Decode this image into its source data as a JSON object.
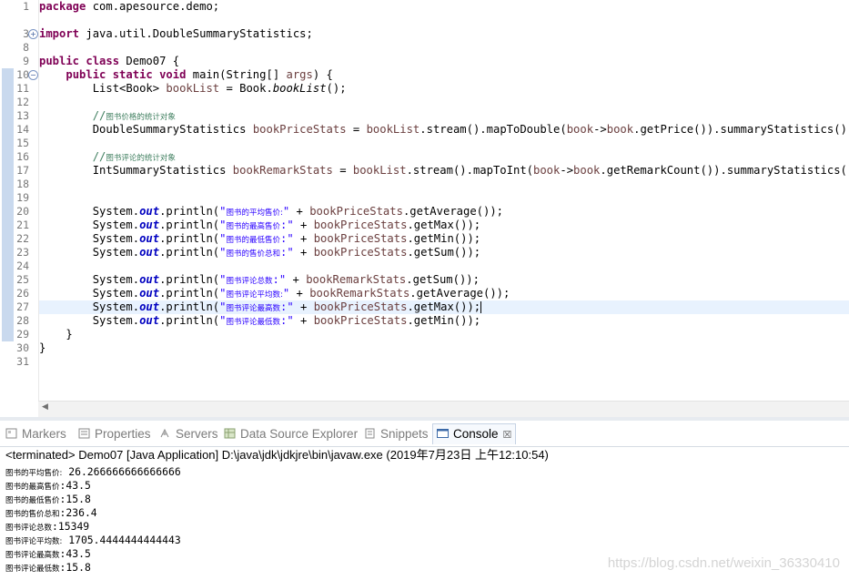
{
  "editor": {
    "line_numbers": [
      "1",
      "3",
      "8",
      "9",
      "10",
      "11",
      "12",
      "13",
      "14",
      "15",
      "16",
      "17",
      "18",
      "19",
      "20",
      "21",
      "22",
      "23",
      "24",
      "25",
      "26",
      "27",
      "28",
      "29",
      "30",
      "31"
    ],
    "lines": {
      "l1": {
        "kw": "package",
        "rest": " com.apesource.demo;"
      },
      "l3": {
        "kw": "import",
        "rest": " java.util.DoubleSummaryStatistics;"
      },
      "l9": {
        "kw": "public class",
        "rest": " Demo07 {"
      },
      "l10": {
        "kw": "public static void",
        "rest": " main(String[] ",
        "var": "args",
        "tail": ") {"
      },
      "l11": {
        "pre": "List<Book> ",
        "var": "bookList",
        "mid": " = Book.",
        "it": "bookList",
        "tail": "();"
      },
      "l13": {
        "comment_prefix": "//",
        "comment": "图书价格的统计对象"
      },
      "l14": {
        "pre": "DoubleSummaryStatistics ",
        "var": "bookPriceStats",
        "mid": " = ",
        "var2": "bookList",
        "mid2": ".stream().mapToDouble(",
        "var3": "book",
        "mid3": "->",
        "var4": "book",
        "tail": ".getPrice()).summaryStatistics();"
      },
      "l16": {
        "comment_prefix": "//",
        "comment": "图书评论的统计对象"
      },
      "l17": {
        "pre": "IntSummaryStatistics ",
        "var": "bookRemarkStats",
        "mid": " = ",
        "var2": "bookList",
        "mid2": ".stream().mapToInt(",
        "var3": "book",
        "mid3": "->",
        "var4": "book",
        "tail": ".getRemarkCount()).summaryStatistics();"
      },
      "l20": {
        "pre": "System.",
        "fld": "out",
        "mid": ".println(",
        "str_q": "\"",
        "str_cn": "图书的平均售价:",
        "str_end": "\"",
        "plus": " + ",
        "var": "bookPriceStats",
        "tail": ".getAverage());"
      },
      "l21": {
        "pre": "System.",
        "fld": "out",
        "mid": ".println(",
        "str_q": "\"",
        "str_cn": "图书的最高售价",
        "str_end": ":\"",
        "plus": " + ",
        "var": "bookPriceStats",
        "tail": ".getMax());"
      },
      "l22": {
        "pre": "System.",
        "fld": "out",
        "mid": ".println(",
        "str_q": "\"",
        "str_cn": "图书的最低售价",
        "str_end": ":\"",
        "plus": " + ",
        "var": "bookPriceStats",
        "tail": ".getMin());"
      },
      "l23": {
        "pre": "System.",
        "fld": "out",
        "mid": ".println(",
        "str_q": "\"",
        "str_cn": "图书的售价总和",
        "str_end": ":\"",
        "plus": " + ",
        "var": "bookPriceStats",
        "tail": ".getSum());"
      },
      "l25": {
        "pre": "System.",
        "fld": "out",
        "mid": ".println(",
        "str_q": "\"",
        "str_cn": "图书评论总数",
        "str_end": ":\"",
        "plus": " + ",
        "var": "bookRemarkStats",
        "tail": ".getSum());"
      },
      "l26": {
        "pre": "System.",
        "fld": "out",
        "mid": ".println(",
        "str_q": "\"",
        "str_cn": "图书评论平均数:",
        "str_end": "\"",
        "plus": " + ",
        "var": "bookRemarkStats",
        "tail": ".getAverage());"
      },
      "l27": {
        "pre": "System.",
        "fld": "out",
        "mid": ".println(",
        "str_q": "\"",
        "str_cn": "图书评论最高数",
        "str_end": ":\"",
        "plus": " + ",
        "var": "bookPriceStats",
        "tail": ".getMax());"
      },
      "l28": {
        "pre": "System.",
        "fld": "out",
        "mid": ".println(",
        "str_q": "\"",
        "str_cn": "图书评论最低数",
        "str_end": ":\"",
        "plus": " + ",
        "var": "bookPriceStats",
        "tail": ".getMin());"
      },
      "l29": {
        "text": "}"
      },
      "l30": {
        "text": "}"
      }
    }
  },
  "panel": {
    "tabs": [
      {
        "label": "Markers",
        "icon": "markers-icon"
      },
      {
        "label": "Properties",
        "icon": "properties-icon"
      },
      {
        "label": "Servers",
        "icon": "servers-icon"
      },
      {
        "label": "Data Source Explorer",
        "icon": "data-source-icon"
      },
      {
        "label": "Snippets",
        "icon": "snippets-icon"
      },
      {
        "label": "Console",
        "icon": "console-icon",
        "active": true
      }
    ],
    "close_glyph": "☒",
    "console_header": "<terminated> Demo07 [Java Application] D:\\java\\jdk\\jdkjre\\bin\\javaw.exe (2019年7月23日 上午12:10:54)",
    "output": [
      {
        "label": "图书的平均售价:",
        "value": " 26.266666666666666"
      },
      {
        "label": "图书的最高售价",
        "value": ":43.5"
      },
      {
        "label": "图书的最低售价",
        "value": ":15.8"
      },
      {
        "label": "图书的售价总和",
        "value": ":236.4"
      },
      {
        "label": "图书评论总数",
        "value": ":15349"
      },
      {
        "label": "图书评论平均数:",
        "value": " 1705.4444444444443"
      },
      {
        "label": "图书评论最高数",
        "value": ":43.5"
      },
      {
        "label": "图书评论最低数",
        "value": ":15.8"
      }
    ]
  },
  "watermark": "https://blog.csdn.net/weixin_36330410",
  "colors": {
    "keyword": "#7f0055",
    "string": "#2a00ff",
    "comment": "#3f7f5f",
    "field": "#0000c0",
    "local_var": "#6a3e3e"
  }
}
